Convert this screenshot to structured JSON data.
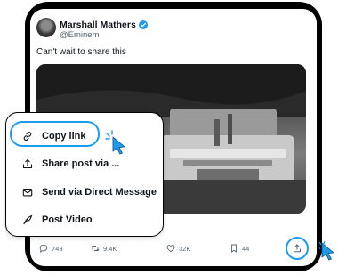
{
  "tweet": {
    "author_name": "Marshall Mathers",
    "handle": "@Eminem",
    "text": "Can't wait to share this"
  },
  "actions": {
    "replies": "743",
    "reposts": "9.4K",
    "likes": "32K",
    "views": "44"
  },
  "share_menu": {
    "items": [
      {
        "label": "Copy link",
        "icon": "link-icon"
      },
      {
        "label": "Share post via ...",
        "icon": "share-icon"
      },
      {
        "label": "Send via Direct Message",
        "icon": "mail-icon"
      },
      {
        "label": "Post Video",
        "icon": "feather-icon"
      }
    ]
  },
  "colors": {
    "accent": "#1d9bf0",
    "frame": "#000000",
    "text": "#0f1419",
    "muted": "#536471"
  }
}
